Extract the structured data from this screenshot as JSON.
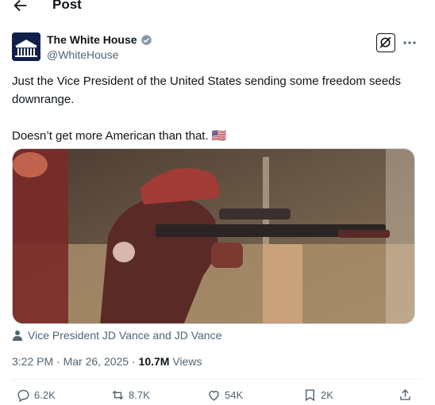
{
  "header": {
    "title": "Post"
  },
  "author": {
    "name": "The White House",
    "handle": "@WhiteHouse"
  },
  "tweet": {
    "line1": "Just the Vice President of the United States sending some freedom seeds downrange.",
    "line2": "Doesn’t get more American than that. 🇺🇸"
  },
  "media": {
    "caption": "Vice President JD Vance and JD Vance"
  },
  "meta": {
    "time": "3:22 PM",
    "separator": "·",
    "date": "Mar 26, 2025",
    "views_count": "10.7M",
    "views_label": "Views"
  },
  "actions": {
    "replies": "6.2K",
    "reposts": "8.7K",
    "likes": "54K",
    "bookmarks": "2K"
  },
  "colors": {
    "text": "#0f1419",
    "secondary": "#536471",
    "verified_badge": "#829aab",
    "divider": "#eff3f4"
  },
  "icons": [
    "back-arrow-icon",
    "verified-badge-icon",
    "grok-icon",
    "more-icon",
    "person-icon",
    "reply-icon",
    "repost-icon",
    "like-icon",
    "bookmark-icon",
    "share-icon"
  ]
}
